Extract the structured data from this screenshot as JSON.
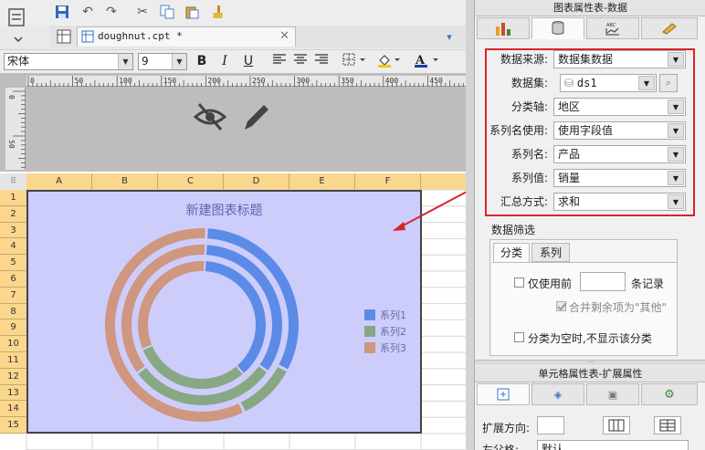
{
  "toolbar": {
    "tab_name": "doughnut.cpt *",
    "font_name": "宋体",
    "font_size": "9",
    "bold": "B",
    "italic": "I",
    "underline": "U"
  },
  "ruler": {
    "h_ticks": [
      "0",
      "50",
      "100",
      "150",
      "200",
      "250",
      "300",
      "350",
      "400",
      "450"
    ],
    "v_ticks": [
      "0",
      "50"
    ]
  },
  "grid": {
    "columns": [
      "A",
      "B",
      "C",
      "D",
      "E",
      "F"
    ],
    "rows": [
      "1",
      "2",
      "3",
      "4",
      "5",
      "6",
      "7",
      "8",
      "9",
      "10",
      "11",
      "12",
      "13",
      "14",
      "15"
    ]
  },
  "chart_data": {
    "type": "doughnut",
    "title": "新建图表标题",
    "series": [
      {
        "name": "系列1",
        "color": "#5b8be6"
      },
      {
        "name": "系列2",
        "color": "#87a882"
      },
      {
        "name": "系列3",
        "color": "#cf9680"
      }
    ],
    "rings": [
      {
        "series": "系列3",
        "values": [
          {
            "series_name": "系列1",
            "value": 0.32
          },
          {
            "series_name": "系列2",
            "value": 0.1
          },
          {
            "series_name": "系列3",
            "value": 0.58
          }
        ]
      },
      {
        "series": "系列2",
        "values": [
          {
            "series_name": "系列1",
            "value": 0.34
          },
          {
            "series_name": "系列2",
            "value": 0.3
          },
          {
            "series_name": "系列3",
            "value": 0.36
          }
        ]
      },
      {
        "series": "系列1",
        "values": [
          {
            "series_name": "系列1",
            "value": 0.38
          },
          {
            "series_name": "系列2",
            "value": 0.3
          },
          {
            "series_name": "系列3",
            "value": 0.32
          }
        ]
      }
    ],
    "legend_position": "right"
  },
  "right_panel": {
    "title": "图表属性表-数据",
    "fields": [
      {
        "label": "数据来源:",
        "value": "数据集数据"
      },
      {
        "label": "数据集:",
        "value": "ds1"
      },
      {
        "label": "分类轴:",
        "value": "地区"
      },
      {
        "label": "系列名使用:",
        "value": "使用字段值"
      },
      {
        "label": "系列名:",
        "value": "产品"
      },
      {
        "label": "系列值:",
        "value": "销量"
      },
      {
        "label": "汇总方式:",
        "value": "求和"
      }
    ],
    "filter": {
      "title": "数据筛选",
      "tabs": [
        "分类",
        "系列"
      ],
      "use_top": "仅使用前",
      "records_suffix": "条记录",
      "merge_rest": "合并剩余项为\"其他\"",
      "hide_empty": "分类为空时,不显示该分类"
    },
    "cell_panel_title": "单元格属性表-扩展属性",
    "expand_direction_label": "扩展方向:",
    "parent_label": "左父格:",
    "parent_value": "默认"
  }
}
